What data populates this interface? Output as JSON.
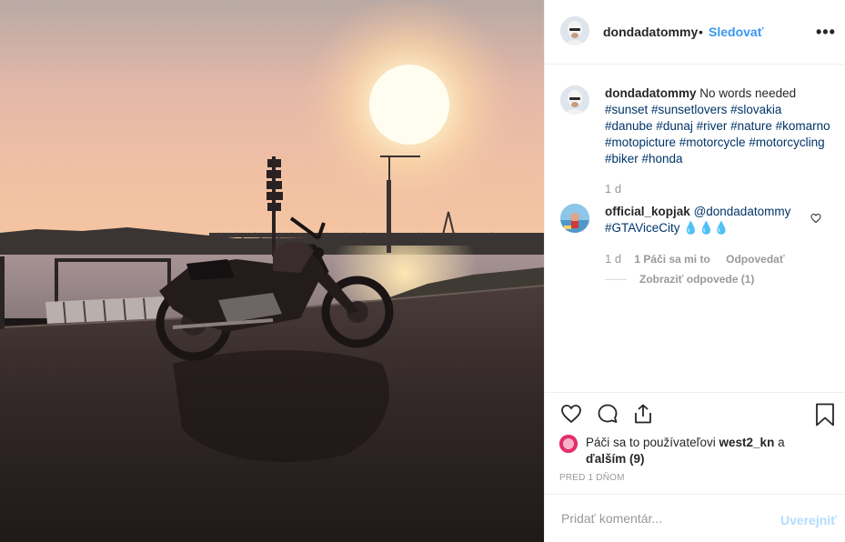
{
  "post": {
    "author": "dondadatommy",
    "follow_label": "Sledovať",
    "separator": "•",
    "more_label": "•••"
  },
  "caption": {
    "username": "dondadatommy",
    "text": "No words needed",
    "hashtags": "#sunset #sunsetlovers #slovakia #danube #dunaj #river #nature #komarno #motopicture #motorcycle #motorcycling #biker #honda",
    "time": "1 d"
  },
  "comment": {
    "username": "official_kopjak",
    "mention": "@dondadatommy",
    "text": "#GTAViceCity 💧💧💧",
    "time": "1 d",
    "likes_label": "1 Páči sa mi to",
    "reply_label": "Odpovedať",
    "view_replies_label": "Zobraziť odpovede (1)"
  },
  "likes": {
    "prefix": "Páči sa to používateľovi",
    "user": "west2_kn",
    "suffix": "a",
    "others": "ďalším (9)"
  },
  "date_label": "PRED 1 DŇOM",
  "add_comment": {
    "placeholder": "Pridať komentár...",
    "post_label": "Uverejniť"
  },
  "colors": {
    "link_blue": "#3897f0",
    "hashtag_blue": "#003569",
    "muted_gray": "#999999",
    "post_disabled": "#b3dbff"
  },
  "icons": [
    "heart-icon",
    "comment-icon",
    "share-icon",
    "bookmark-icon",
    "more-icon"
  ]
}
